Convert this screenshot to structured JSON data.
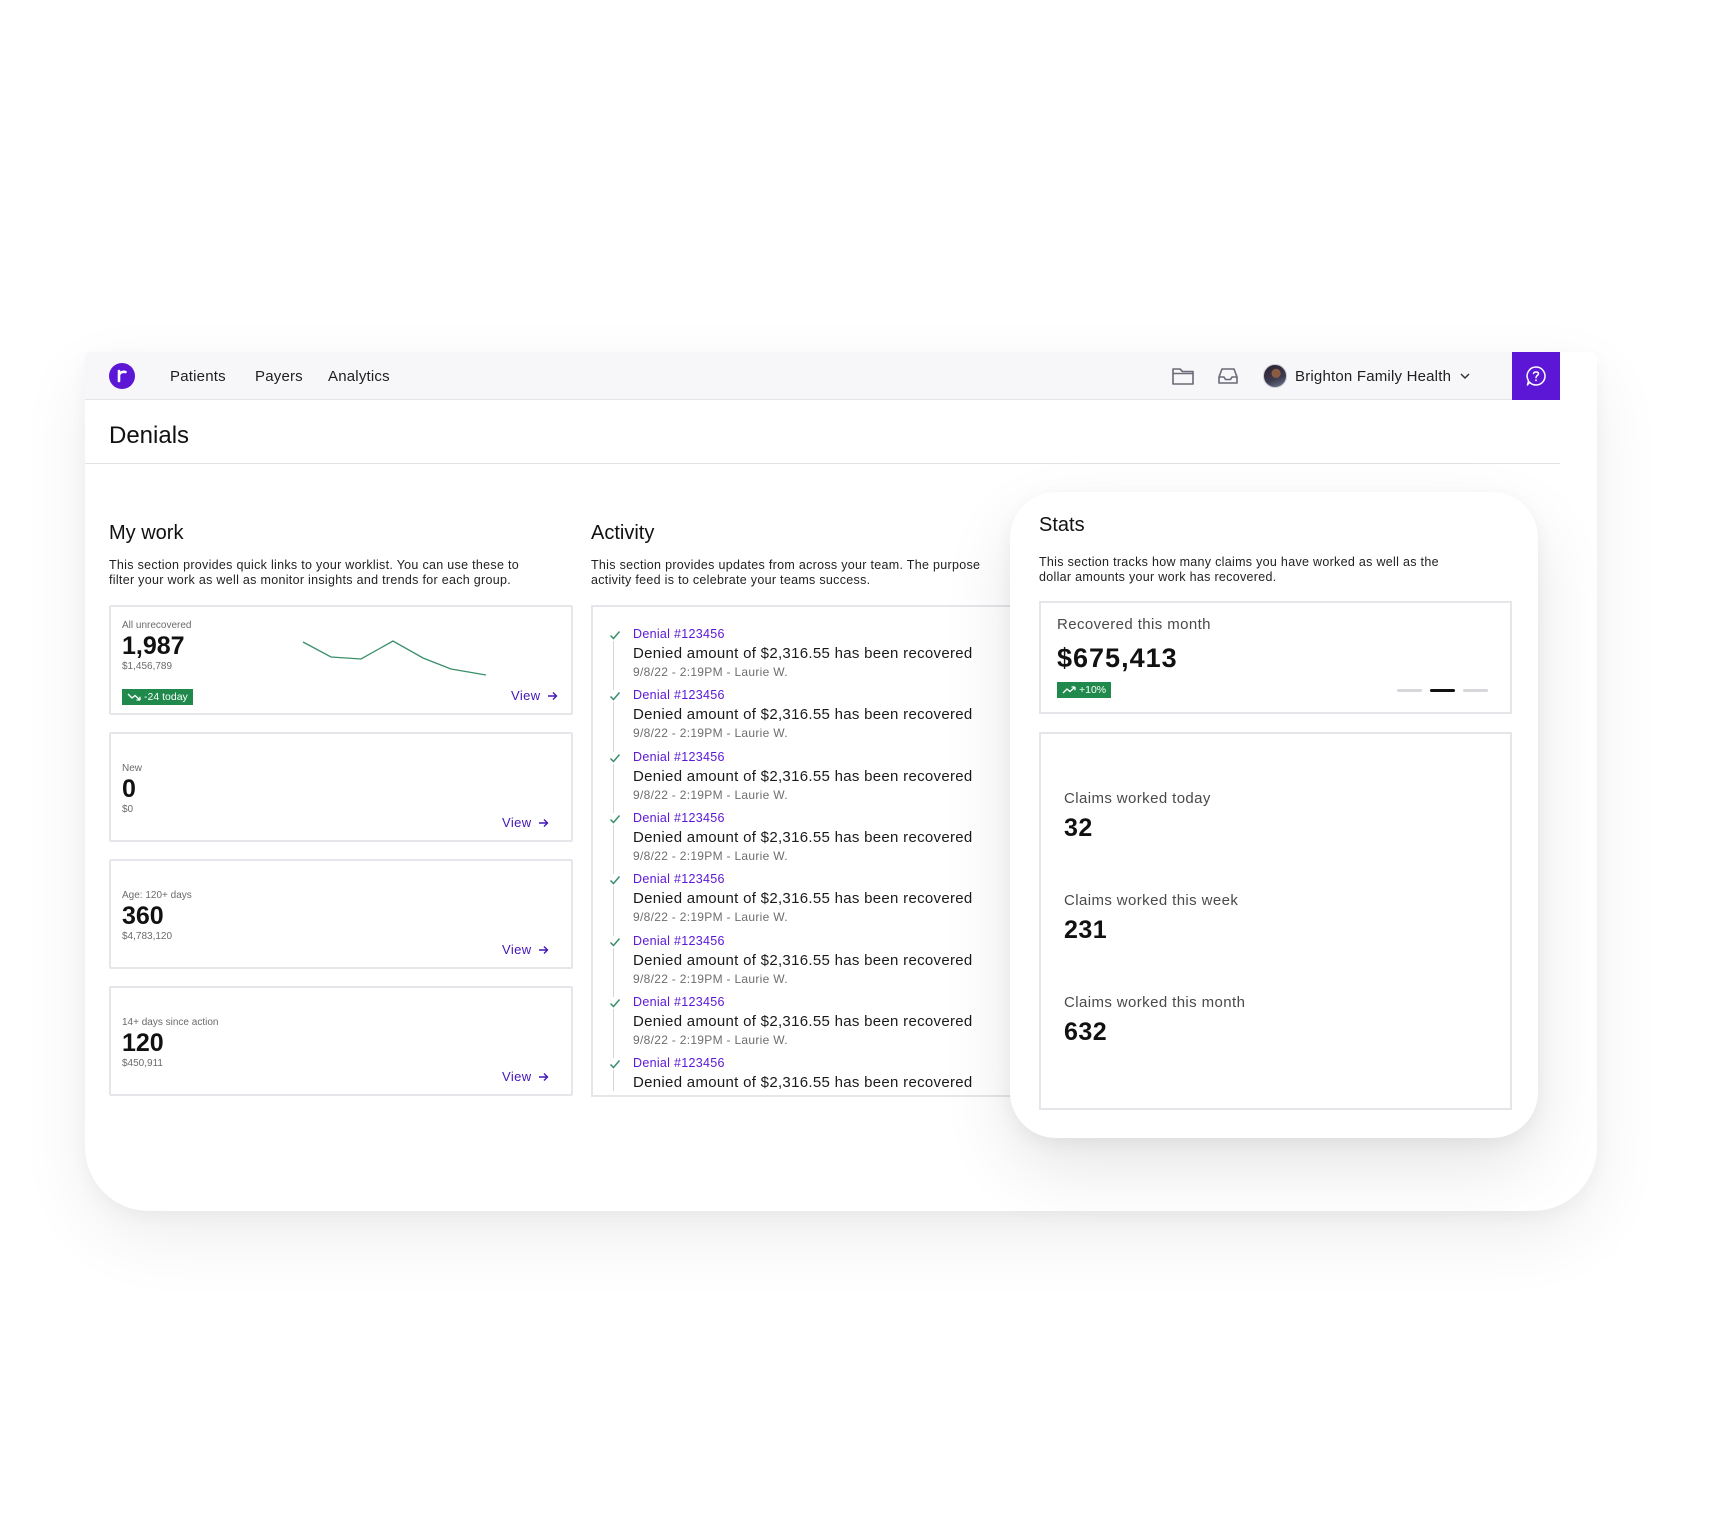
{
  "nav": {
    "links": [
      "Patients",
      "Payers",
      "Analytics"
    ],
    "org_name": "Brighton Family Health",
    "icons": [
      "folder-icon",
      "inbox-icon",
      "chevron-down-icon",
      "help-icon"
    ]
  },
  "page": {
    "title": "Denials"
  },
  "my_work": {
    "title": "My work",
    "description_line1": "This section provides quick links to your worklist. You can use these to",
    "description_line2": "filter your work as well as monitor insights and trends for each group.",
    "cards": [
      {
        "label": "All unrecovered",
        "value": "1,987",
        "amount": "$1,456,789",
        "badge": "-24 today",
        "view": "View"
      },
      {
        "label": "New",
        "value": "0",
        "amount": "$0",
        "view": "View"
      },
      {
        "label": "Age: 120+ days",
        "value": "360",
        "amount": "$4,783,120",
        "view": "View"
      },
      {
        "label": "14+ days since action",
        "value": "120",
        "amount": "$450,911",
        "view": "View"
      }
    ]
  },
  "activity": {
    "title": "Activity",
    "description_line1": "This section provides updates from across your team. The purpose",
    "description_line2": "activity feed is to celebrate your teams success.",
    "items": [
      {
        "id": "Denial #123456",
        "text": "Denied amount of $2,316.55 has been recovered",
        "meta": "9/8/22 - 2:19PM - Laurie W."
      },
      {
        "id": "Denial #123456",
        "text": "Denied amount of $2,316.55 has been recovered",
        "meta": "9/8/22 - 2:19PM - Laurie W."
      },
      {
        "id": "Denial #123456",
        "text": "Denied amount of $2,316.55 has been recovered",
        "meta": "9/8/22 - 2:19PM - Laurie W."
      },
      {
        "id": "Denial #123456",
        "text": "Denied amount of $2,316.55 has been recovered",
        "meta": "9/8/22 - 2:19PM - Laurie W."
      },
      {
        "id": "Denial #123456",
        "text": "Denied amount of $2,316.55 has been recovered",
        "meta": "9/8/22 - 2:19PM - Laurie W."
      },
      {
        "id": "Denial #123456",
        "text": "Denied amount of $2,316.55 has been recovered",
        "meta": "9/8/22 - 2:19PM - Laurie W."
      },
      {
        "id": "Denial #123456",
        "text": "Denied amount of $2,316.55 has been recovered",
        "meta": "9/8/22 - 2:19PM - Laurie W."
      },
      {
        "id": "Denial #123456",
        "text": "Denied amount of $2,316.55 has been recovered",
        "meta": ""
      }
    ]
  },
  "stats": {
    "title": "Stats",
    "description_line1": "This section tracks how many claims you have worked as well as the",
    "description_line2": "dollar amounts your work has recovered.",
    "recovered_label": "Recovered this month",
    "recovered_value": "$675,413",
    "recovered_badge": "+10%",
    "carousel_active_index": 1,
    "claims": [
      {
        "label": "Claims worked today",
        "value": "32"
      },
      {
        "label": "Claims worked this week",
        "value": "231"
      },
      {
        "label": "Claims worked this month",
        "value": "632"
      }
    ]
  },
  "colors": {
    "brand": "#5b16d6",
    "link": "#4316b8",
    "positive": "#1f8a4c",
    "sparkline": "#3a8f6a"
  }
}
